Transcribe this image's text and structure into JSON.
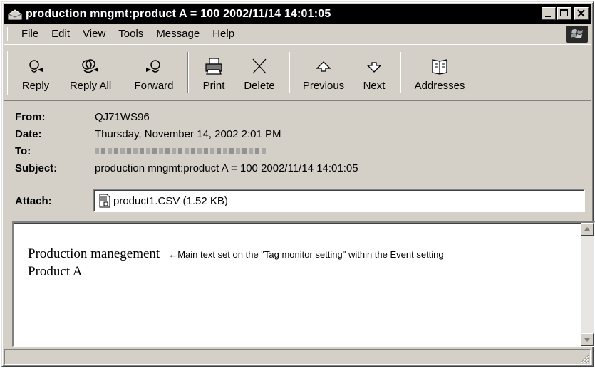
{
  "window": {
    "title": "production mngmt:product A = 100 2002/11/14 14:01:05"
  },
  "menu": {
    "items": [
      {
        "label": "File"
      },
      {
        "label": "Edit"
      },
      {
        "label": "View"
      },
      {
        "label": "Tools"
      },
      {
        "label": "Message"
      },
      {
        "label": "Help"
      }
    ]
  },
  "toolbar": {
    "buttons": [
      {
        "label": "Reply",
        "icon": "reply-icon"
      },
      {
        "label": "Reply All",
        "icon": "reply-all-icon"
      },
      {
        "label": "Forward",
        "icon": "forward-icon"
      },
      {
        "label": "Print",
        "icon": "print-icon"
      },
      {
        "label": "Delete",
        "icon": "delete-icon"
      },
      {
        "label": "Previous",
        "icon": "previous-icon"
      },
      {
        "label": "Next",
        "icon": "next-icon"
      },
      {
        "label": "Addresses",
        "icon": "addresses-icon"
      }
    ]
  },
  "header": {
    "from": {
      "label": "From:",
      "value": "QJ71WS96"
    },
    "date": {
      "label": "Date:",
      "value": "Thursday, November 14, 2002 2:01 PM"
    },
    "to": {
      "label": "To:"
    },
    "subject": {
      "label": "Subject:",
      "value": "production mngmt:product A = 100 2002/11/14 14:01:05"
    },
    "attach": {
      "label": "Attach:",
      "file": "product1.CSV (1.52 KB)"
    }
  },
  "body": {
    "line1": "Production manegement",
    "annotation": "←Main text set on the \"Tag monitor setting\" within the Event setting",
    "line2": "Product A"
  }
}
